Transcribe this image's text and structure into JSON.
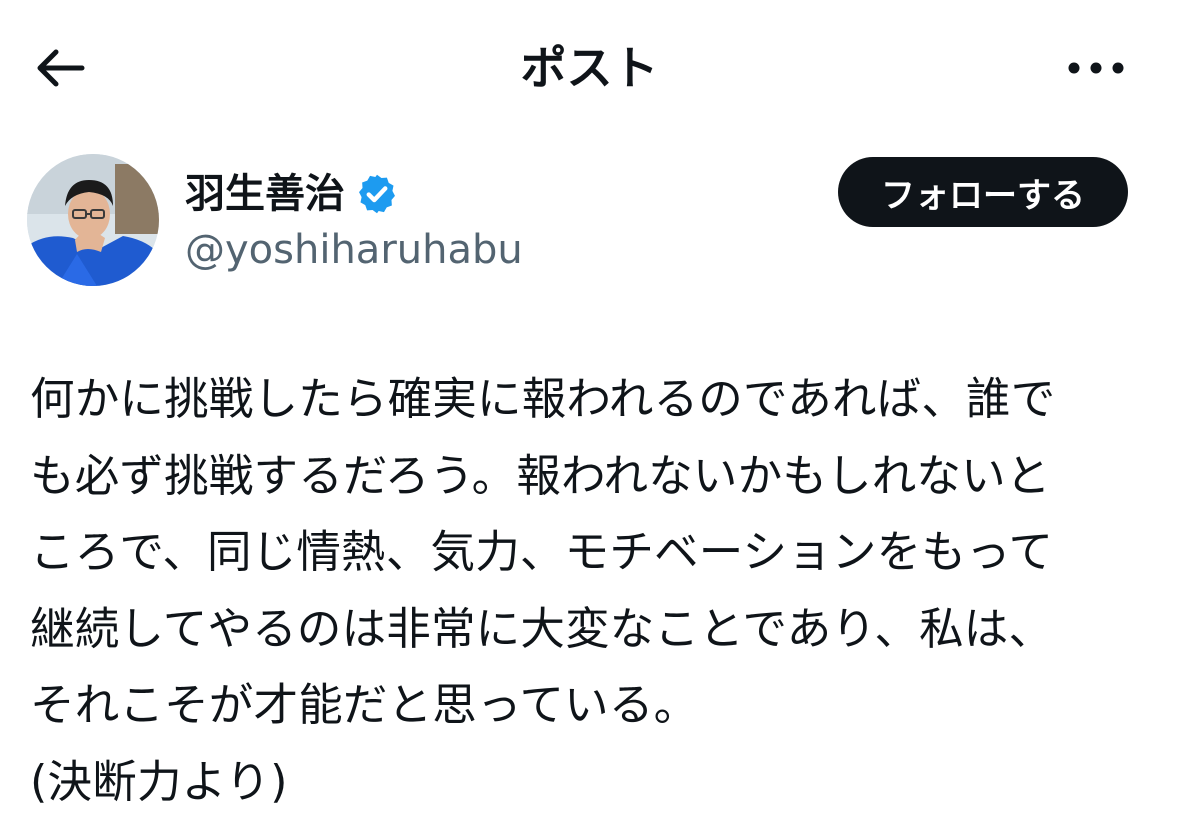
{
  "header": {
    "title": "ポスト"
  },
  "author": {
    "display_name": "羽生善治",
    "handle": "@yoshiharuhabu",
    "verified": true
  },
  "follow_button": {
    "label": "フォローする"
  },
  "post": {
    "lines": [
      "何かに挑戦したら確実に報われるのであれば、誰で",
      "も必ず挑戦するだろう。報われないかもしれないと",
      "ころで、同じ情熱、気力、モチベーションをもって",
      "継続してやるのは非常に大変なことであり、私は、",
      "それこそが才能だと思っている。",
      "(決断力より)"
    ]
  },
  "icons": {
    "back": "arrow-left-icon",
    "more": "more-horizontal-icon",
    "verified": "verified-badge-icon"
  },
  "colors": {
    "text": "#0f1419",
    "secondary_text": "#536471",
    "verified_blue": "#1d9bf0",
    "button_bg": "#0f1419",
    "button_text": "#ffffff"
  }
}
